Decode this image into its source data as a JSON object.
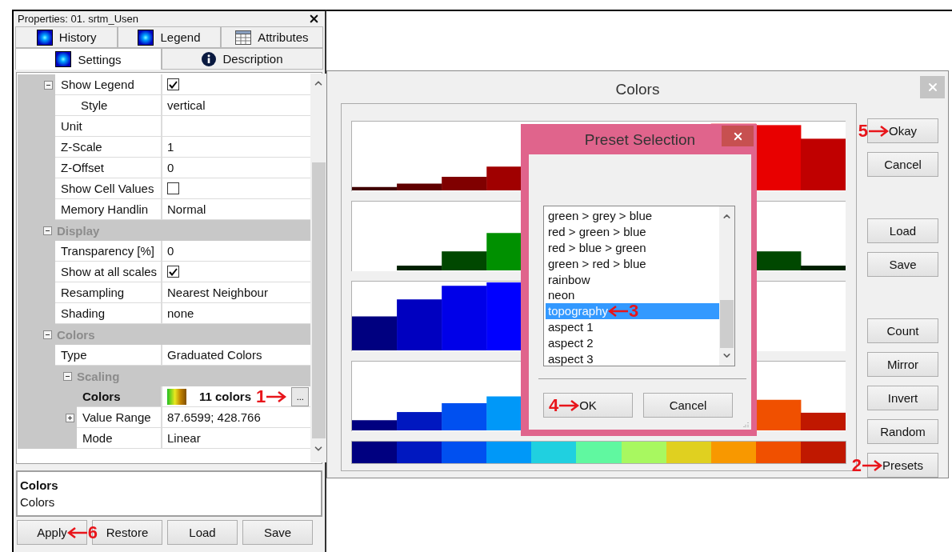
{
  "properties_panel": {
    "title": "Properties: 01. srtm_Usen",
    "tab_rows": [
      [
        {
          "label": "History",
          "kind": "layer",
          "selected": false
        },
        {
          "label": "Legend",
          "kind": "layer",
          "selected": false
        },
        {
          "label": "Attributes",
          "kind": "table",
          "selected": false
        }
      ],
      [
        {
          "label": "Settings",
          "kind": "layer",
          "selected": true
        },
        {
          "label": "Description",
          "kind": "info",
          "selected": false
        }
      ]
    ],
    "grid": [
      {
        "kind": "property",
        "label": "Show Legend",
        "checked": true,
        "expanded": true,
        "selected": false,
        "children": [
          {
            "kind": "property",
            "label": "Style",
            "value": "vertical",
            "selected": false
          }
        ]
      },
      {
        "kind": "property",
        "label": "Unit",
        "selected": false
      },
      {
        "kind": "property",
        "label": "Z-Scale",
        "value": "1",
        "selected": false
      },
      {
        "kind": "property",
        "label": "Z-Offset",
        "value": "0",
        "selected": false
      },
      {
        "kind": "property",
        "label": "Show Cell Values",
        "checked": false,
        "selected": false
      },
      {
        "kind": "property",
        "label": "Memory Handlin",
        "value": "Normal",
        "selected": false
      },
      {
        "kind": "category",
        "label": "Display",
        "expanded": true,
        "children": [
          {
            "kind": "property",
            "label": "Transparency [%]",
            "value": "0",
            "selected": false
          },
          {
            "kind": "property",
            "label": "Show at all scales",
            "checked": true,
            "selected": false
          },
          {
            "kind": "property",
            "label": "Resampling",
            "value": "Nearest Neighbour",
            "selected": false
          },
          {
            "kind": "property",
            "label": "Shading",
            "value": "none",
            "selected": false
          }
        ]
      },
      {
        "kind": "category",
        "label": "Colors",
        "expanded": true,
        "children": [
          {
            "kind": "property",
            "label": "Type",
            "value": "Graduated Colors",
            "selected": false
          },
          {
            "kind": "category",
            "label": "Scaling",
            "expanded": true,
            "children": [
              {
                "kind": "property",
                "label": "Colors",
                "value": "11 colors",
                "swatch": true,
                "button": "...",
                "callout": {
                  "number": "1",
                  "points_left": false
                },
                "selected": true
              },
              {
                "kind": "property",
                "label": "Value Range",
                "value": "87.6599; 428.766",
                "expanded": false,
                "selected": false
              },
              {
                "kind": "property",
                "label": "Mode",
                "value": "Linear",
                "selected": false
              }
            ]
          }
        ]
      }
    ],
    "description": {
      "title": "Colors",
      "text": "Colors"
    },
    "buttons": [
      {
        "label": "Apply",
        "callout": {
          "number": "6",
          "points_left": true
        }
      },
      {
        "label": "Restore"
      },
      {
        "label": "Load"
      },
      {
        "label": "Save"
      }
    ]
  },
  "colors_dialog": {
    "title": "Colors",
    "strip": [
      {
        "color": "#000080"
      },
      {
        "color": "#0018c0"
      },
      {
        "color": "#0050f0"
      },
      {
        "color": "#0098f8"
      },
      {
        "color": "#20d0e0"
      },
      {
        "color": "#60f8a0"
      },
      {
        "color": "#a8f860"
      },
      {
        "color": "#e0d020"
      },
      {
        "color": "#f89800"
      },
      {
        "color": "#f05000"
      },
      {
        "color": "#c01800"
      }
    ],
    "button_groups": [
      [
        {
          "label": "Okay",
          "callout": {
            "number": "5",
            "points_left": false
          }
        },
        {
          "label": "Cancel"
        }
      ],
      [
        {
          "label": "Load"
        },
        {
          "label": "Save"
        }
      ],
      [
        {
          "label": "Count"
        },
        {
          "label": "Mirror"
        },
        {
          "label": "Invert"
        },
        {
          "label": "Random"
        },
        {
          "label": "Presets",
          "callout": {
            "number": "2",
            "points_left": false
          }
        }
      ]
    ]
  },
  "preset_dialog": {
    "title": "Preset Selection",
    "items": [
      {
        "label": "green > grey > blue",
        "selected": false
      },
      {
        "label": "red > green > blue",
        "selected": false
      },
      {
        "label": "red > blue > green",
        "selected": false
      },
      {
        "label": "green > red > blue",
        "selected": false
      },
      {
        "label": "rainbow",
        "selected": false
      },
      {
        "label": "neon",
        "selected": false
      },
      {
        "label": "topography",
        "selected": true,
        "callout": {
          "number": "3",
          "points_left": true
        }
      },
      {
        "label": "aspect 1",
        "selected": false
      },
      {
        "label": "aspect 2",
        "selected": false
      },
      {
        "label": "aspect 3",
        "selected": false
      }
    ],
    "buttons": [
      {
        "label": "OK",
        "callout": {
          "number": "4",
          "points_left": false
        }
      },
      {
        "label": "Cancel"
      }
    ]
  }
}
